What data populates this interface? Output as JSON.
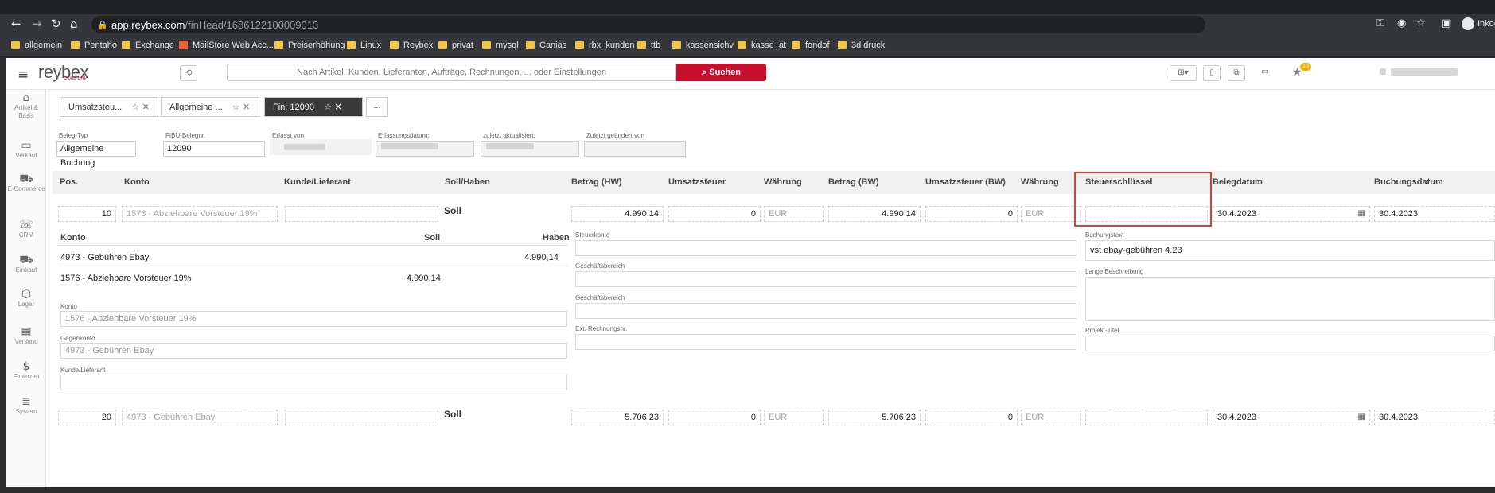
{
  "browser": {
    "url_host": "app.reybex.com",
    "url_path": "/finHead/1686122100009013",
    "profile_label": "Inkog"
  },
  "bookmarks": [
    {
      "label": "allgemein",
      "icon": "folder-icon"
    },
    {
      "label": "Pentaho",
      "icon": "folder-icon"
    },
    {
      "label": "Exchange",
      "icon": "folder-icon"
    },
    {
      "label": "MailStore Web Acc...",
      "icon": "mailstore-icon"
    },
    {
      "label": "Preiserhöhung",
      "icon": "folder-icon"
    },
    {
      "label": "Linux",
      "icon": "folder-icon"
    },
    {
      "label": "Reybex",
      "icon": "folder-icon"
    },
    {
      "label": "privat",
      "icon": "folder-icon"
    },
    {
      "label": "mysql",
      "icon": "folder-icon"
    },
    {
      "label": "Canias",
      "icon": "folder-icon"
    },
    {
      "label": "rbx_kunden",
      "icon": "folder-icon"
    },
    {
      "label": "ttb",
      "icon": "folder-icon"
    },
    {
      "label": "kassensichv",
      "icon": "folder-icon"
    },
    {
      "label": "kasse_at",
      "icon": "folder-icon"
    },
    {
      "label": "fondof",
      "icon": "folder-icon"
    },
    {
      "label": "3d druck",
      "icon": "folder-icon"
    }
  ],
  "app": {
    "logo": "reybex",
    "logo_sub": "Cloud ERP",
    "search_placeholder": "Nach Artikel, Kunden, Lieferanten, Aufträge, Rechnungen, ... oder Einstellungen",
    "search_button": "Suchen",
    "notification_count": "10"
  },
  "sidebar": [
    {
      "label": "Artikel & Basis",
      "icon": "home-icon"
    },
    {
      "label": "Verkauf",
      "icon": "card-icon"
    },
    {
      "label": "E-Commerce",
      "icon": "cart-icon"
    },
    {
      "label": "CRM",
      "icon": "contacts-icon"
    },
    {
      "label": "Einkauf",
      "icon": "truck-icon"
    },
    {
      "label": "Lager",
      "icon": "box-icon"
    },
    {
      "label": "Versand",
      "icon": "package-icon"
    },
    {
      "label": "Finanzen",
      "icon": "dollar-icon"
    },
    {
      "label": "System",
      "icon": "database-icon"
    }
  ],
  "tabs": [
    {
      "label": "Umsatzsteu..."
    },
    {
      "label": "Allgemeine ..."
    },
    {
      "label": "Fin: 12090"
    }
  ],
  "tab_more": "...",
  "header": {
    "beleg_typ_label": "Beleg-Typ",
    "beleg_typ": "Allgemeine Buchung",
    "fibu_label": "FIBU-Belegnr.",
    "fibu": "12090",
    "erfasst_label": "Erfasst von",
    "erfassungsdatum_label": "Erfassungsdatum:",
    "aktualisiert_label": "zuletzt aktualisiert:",
    "geaendert_label": "Zuletzt geändert von"
  },
  "columns": {
    "pos": "Pos.",
    "konto": "Konto",
    "kunde": "Kunde/Lieferant",
    "sollhaben": "Soll/Haben",
    "betrag_hw": "Betrag (HW)",
    "ust": "Umsatzsteuer",
    "waehrung": "Währung",
    "betrag_bw": "Betrag (BW)",
    "ust_bw": "Umsatzsteuer (BW)",
    "waehrung2": "Währung",
    "steuerschluessel": "Steuerschlüssel",
    "belegdatum": "Belegdatum",
    "buchungsdatum": "Buchungsdatum"
  },
  "rows": [
    {
      "pos": "10",
      "konto": "1576 - Abziehbare Vorsteuer 19%",
      "sollhaben": "Soll",
      "betrag_hw": "4.990,14",
      "ust": "0",
      "waehrung": "EUR",
      "betrag_bw": "4.990,14",
      "ust_bw": "0",
      "waehrung2": "EUR",
      "belegdatum": "30.4.2023",
      "buchungsdatum": "30.4.2023"
    },
    {
      "pos": "20",
      "konto": "4973 - Gebühren Ebay",
      "sollhaben": "Soll",
      "betrag_hw": "5.706,23",
      "ust": "0",
      "waehrung": "EUR",
      "betrag_bw": "5.706,23",
      "ust_bw": "0",
      "waehrung2": "EUR",
      "belegdatum": "30.4.2023",
      "buchungsdatum": "30.4.2023"
    }
  ],
  "detail": {
    "konto_head": "Konto",
    "soll_head": "Soll",
    "haben_head": "Haben",
    "line1_konto": "4973 - Gebühren Ebay",
    "line1_haben": "4.990,14",
    "line2_konto": "1576 - Abziehbare Vorsteuer 19%",
    "line2_soll": "4.990,14",
    "konto_label": "Konto",
    "konto_value": "1576 - Abziehbare Vorsteuer 19%",
    "gegenkonto_label": "Gegenkonto",
    "gegenkonto_value": "4973 - Gebühren Ebay",
    "kunde_label": "Kunde/Lieferant",
    "steuerkonto_label": "Steuerkonto",
    "geschaeftsbereich_label": "Geschäftsbereich",
    "geschaeftsbereich2_label": "Geschäftsbereich",
    "ext_label": "Ext. Rechnungsnr.",
    "buchungstext_label": "Buchungstext",
    "buchungstext_value": "vst ebay-gebühren 4.23",
    "lange_label": "Lange Beschreibung",
    "projekt_label": "Projekt-Titel"
  },
  "colors": {
    "accent": "#c8102e",
    "highlight": "#e23b3b",
    "active_tab": "#3a3a3a"
  }
}
